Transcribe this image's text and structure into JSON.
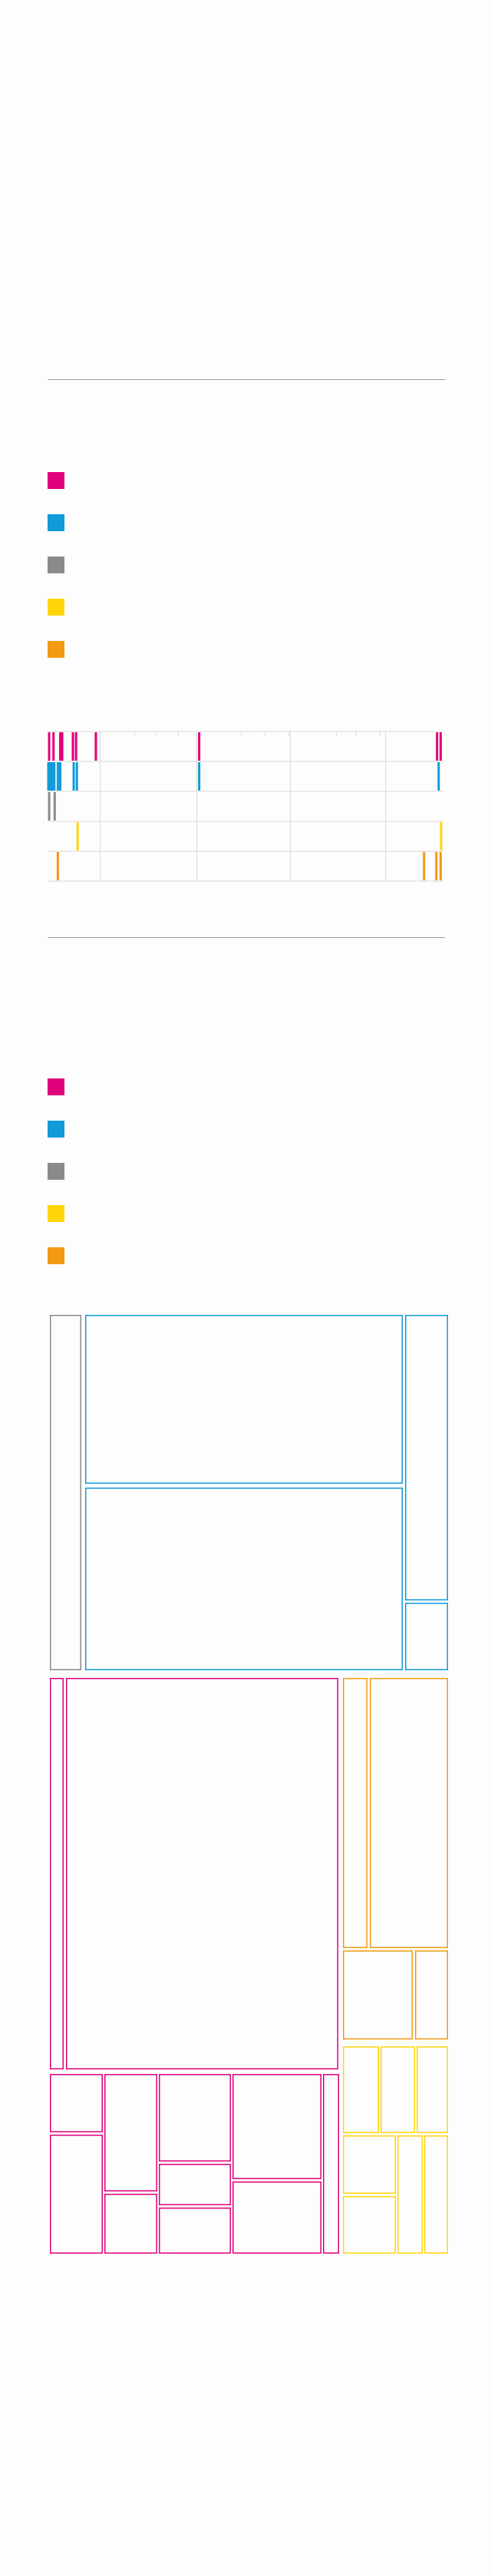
{
  "colors": {
    "magenta": "#e0007a",
    "blue": "#119bd9",
    "gray": "#8a8a8a",
    "yellow": "#ffd60a",
    "orange": "#f29a12"
  },
  "legend_top": {
    "items": [
      {
        "label": "",
        "color": "#e0007a"
      },
      {
        "label": "",
        "color": "#119bd9"
      },
      {
        "label": "",
        "color": "#8a8a8a"
      },
      {
        "label": "",
        "color": "#ffd60a"
      },
      {
        "label": "",
        "color": "#f29a12"
      }
    ]
  },
  "legend_bottom": {
    "items": [
      {
        "label": "",
        "color": "#e0007a"
      },
      {
        "label": "",
        "color": "#119bd9"
      },
      {
        "label": "",
        "color": "#8a8a8a"
      },
      {
        "label": "",
        "color": "#ffd60a"
      },
      {
        "label": "",
        "color": "#f29a12"
      }
    ]
  },
  "chart_data": [
    {
      "type": "scatter",
      "title": "",
      "xlabel": "",
      "ylabel": "",
      "xlim": [
        0,
        100
      ],
      "grid": true,
      "rows": [
        {
          "series": "magenta",
          "color": "#e0007a",
          "x": [
            0.4,
            1.5,
            3.2,
            3.7,
            6.4,
            7.2,
            12.2,
            38.3,
            98.4,
            99.3
          ]
        },
        {
          "series": "blue",
          "color": "#119bd9",
          "x": [
            0.2,
            0.7,
            1.2,
            1.7,
            2.6,
            3.2,
            6.6,
            7.4,
            38.3,
            98.8
          ]
        },
        {
          "series": "gray",
          "color": "#8a8a8a",
          "x": [
            0.4,
            1.8
          ]
        },
        {
          "series": "yellow",
          "color": "#ffd60a",
          "x": [
            7.6,
            99.4
          ]
        },
        {
          "series": "orange",
          "color": "#f29a12",
          "x": [
            2.6,
            95.1,
            98.2,
            99.3
          ]
        }
      ]
    },
    {
      "type": "treemap",
      "title": "",
      "groups": [
        {
          "series": "gray",
          "color": "#8a8a8a",
          "cells": 1
        },
        {
          "series": "blue",
          "color": "#119bd9",
          "cells": 4
        },
        {
          "series": "magenta",
          "color": "#e0007a",
          "cells": 14
        },
        {
          "series": "orange",
          "color": "#f29a12",
          "cells": 4
        },
        {
          "series": "yellow",
          "color": "#ffd60a",
          "cells": 8
        }
      ]
    }
  ]
}
